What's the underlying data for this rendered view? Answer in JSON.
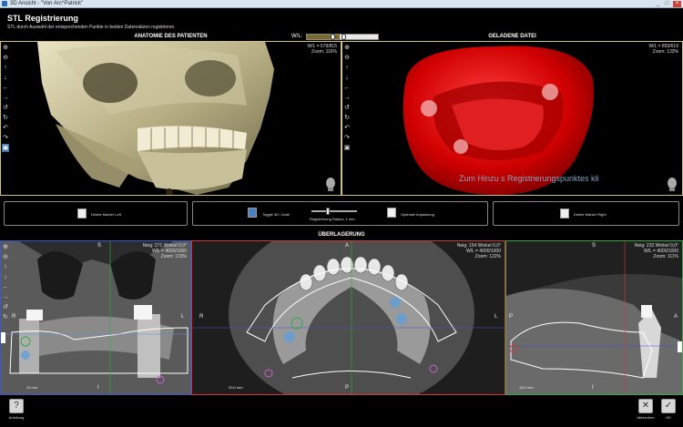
{
  "window": {
    "title": "3D Ansicht - \"Von Arc^Patrick\"",
    "min": "_",
    "max": "□",
    "close": "×"
  },
  "header": {
    "title": "STL Registrierung",
    "subtitle": "STL durch Auswahl der entsprechenden Punkte in beiden Datensätzen registrieren."
  },
  "top_left": {
    "title": "ANATOMIE DES PATIENTEN",
    "wl": "W/L = 579/815",
    "zoom": "Zoom: 116%"
  },
  "wl_control": {
    "label": "W/L:"
  },
  "top_right": {
    "title": "GELADENE DATEI",
    "wl": "W/L = 893/619",
    "zoom": "Zoom: 133%",
    "overlay": "Zum Hinzu        s Registrierungspunktes kli"
  },
  "buttons": {
    "delete_left": "Delete Marker Left",
    "toggle": "Toggle 3D / Axial",
    "radius": "Registrierung Radius: 1 mm",
    "optimize": "Optimale Anpassung",
    "delete_right": "Delete Marker Right"
  },
  "overlay_title": "ÜBERLAGERUNG",
  "bot_left": {
    "info1": "Neig: 271 Winkel 0,0°",
    "info2": "W/L = 4000/1000",
    "info3": "Zoom: 133%",
    "top": "S",
    "left": "R",
    "right": "L",
    "bottom": "I",
    "scale": "10 mm"
  },
  "bot_mid": {
    "info1": "Neig: 154 Winkel 0,0°",
    "info2": "W/L = 4000/1000",
    "info3": "Zoom: 122%",
    "top": "A",
    "left": "R",
    "right": "L",
    "bottom": "P",
    "scale": "20,0 mm"
  },
  "bot_right": {
    "info1": "Neig: 232 Winkel 0,0°",
    "info2": "W/L = 4000/1000",
    "info3": "Zoom: 111%",
    "top": "S",
    "left": "P",
    "right": "A",
    "bottom": "I",
    "scale": "15,0 mm"
  },
  "bottom": {
    "help": "Anleitung",
    "cancel": "Abbrechen",
    "ok": "OK"
  },
  "tool_icons": [
    "zoom-in-icon",
    "zoom-out-icon",
    "arrow-up-icon",
    "arrow-down-icon",
    "arrow-left-icon",
    "arrow-right-icon",
    "rotate-left-icon",
    "rotate-right-icon",
    "undo-icon",
    "redo-icon",
    "screenshot-icon"
  ],
  "colors": {
    "frame_gold": "#cfc27a",
    "frame_blue": "#3c57c9",
    "frame_red": "#d23a3a",
    "frame_green": "#3ba64a",
    "model_red": "#d00000"
  }
}
